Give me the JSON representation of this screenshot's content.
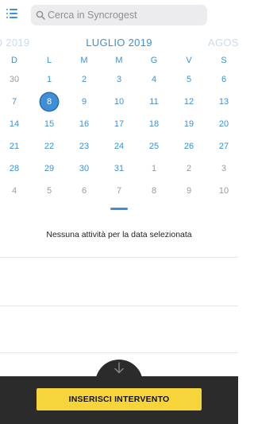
{
  "search": {
    "placeholder": "Cerca in Syncrogest"
  },
  "calendar": {
    "prev_month": "O 2019",
    "current_month": "LUGLIO 2019",
    "next_month": "AGOS",
    "weekdays": [
      "D",
      "L",
      "M",
      "M",
      "G",
      "V",
      "S"
    ],
    "selected_day": "8",
    "weeks": [
      [
        {
          "d": "30",
          "out": true
        },
        {
          "d": "1"
        },
        {
          "d": "2"
        },
        {
          "d": "3"
        },
        {
          "d": "4"
        },
        {
          "d": "5"
        },
        {
          "d": "6"
        }
      ],
      [
        {
          "d": "7"
        },
        {
          "d": "8",
          "sel": true
        },
        {
          "d": "9"
        },
        {
          "d": "10"
        },
        {
          "d": "11"
        },
        {
          "d": "12"
        },
        {
          "d": "13"
        }
      ],
      [
        {
          "d": "14"
        },
        {
          "d": "15"
        },
        {
          "d": "16"
        },
        {
          "d": "17"
        },
        {
          "d": "18"
        },
        {
          "d": "19"
        },
        {
          "d": "20"
        }
      ],
      [
        {
          "d": "21"
        },
        {
          "d": "22"
        },
        {
          "d": "23"
        },
        {
          "d": "24"
        },
        {
          "d": "25"
        },
        {
          "d": "26"
        },
        {
          "d": "27"
        }
      ],
      [
        {
          "d": "28"
        },
        {
          "d": "29"
        },
        {
          "d": "30"
        },
        {
          "d": "31"
        },
        {
          "d": "1",
          "out": true
        },
        {
          "d": "2",
          "out": true
        },
        {
          "d": "3",
          "out": true
        }
      ],
      [
        {
          "d": "4",
          "out": true
        },
        {
          "d": "5",
          "out": true
        },
        {
          "d": "6",
          "out": true
        },
        {
          "d": "7",
          "out": true
        },
        {
          "d": "8",
          "out": true
        },
        {
          "d": "9",
          "out": true
        },
        {
          "d": "10",
          "out": true
        }
      ]
    ]
  },
  "main": {
    "empty_message": "Nessuna attività per la data selezionata"
  },
  "footer": {
    "cta_label": "INSERISCI INTERVENTO"
  },
  "icons": {
    "menu": "list-menu-icon",
    "search": "search-icon",
    "fab": "arrow-down-icon"
  },
  "colors": {
    "accent": "#3e8fd6",
    "footer_bg": "#2b2b2c",
    "cta_bg": "#f5d53a"
  }
}
